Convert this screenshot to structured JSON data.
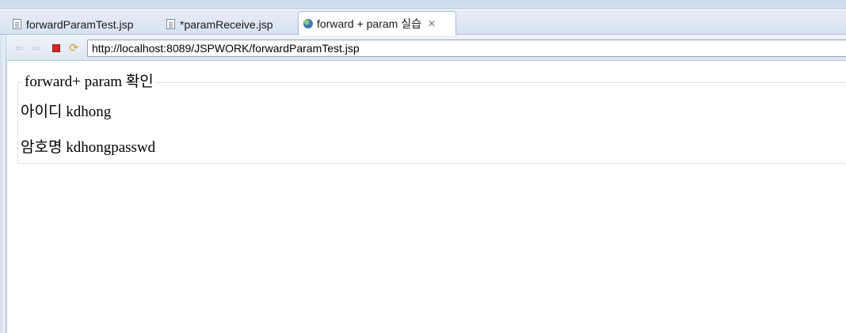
{
  "tabs": [
    {
      "label": "forwardParamTest.jsp",
      "icon": "file-icon"
    },
    {
      "label": "*paramReceive.jsp",
      "icon": "file-icon"
    },
    {
      "label": "forward + param 실습",
      "icon": "globe-icon",
      "active": true
    }
  ],
  "browser": {
    "url": "http://localhost:8089/JSPWORK/forwardParamTest.jsp"
  },
  "page": {
    "legend": "forward+ param 확인",
    "id_label": "아이디",
    "id_value": "kdhong",
    "pw_label": "암호명",
    "pw_value": "kdhongpasswd"
  },
  "colors": {
    "accent": "#a9bed6",
    "stop": "#d8262c"
  }
}
